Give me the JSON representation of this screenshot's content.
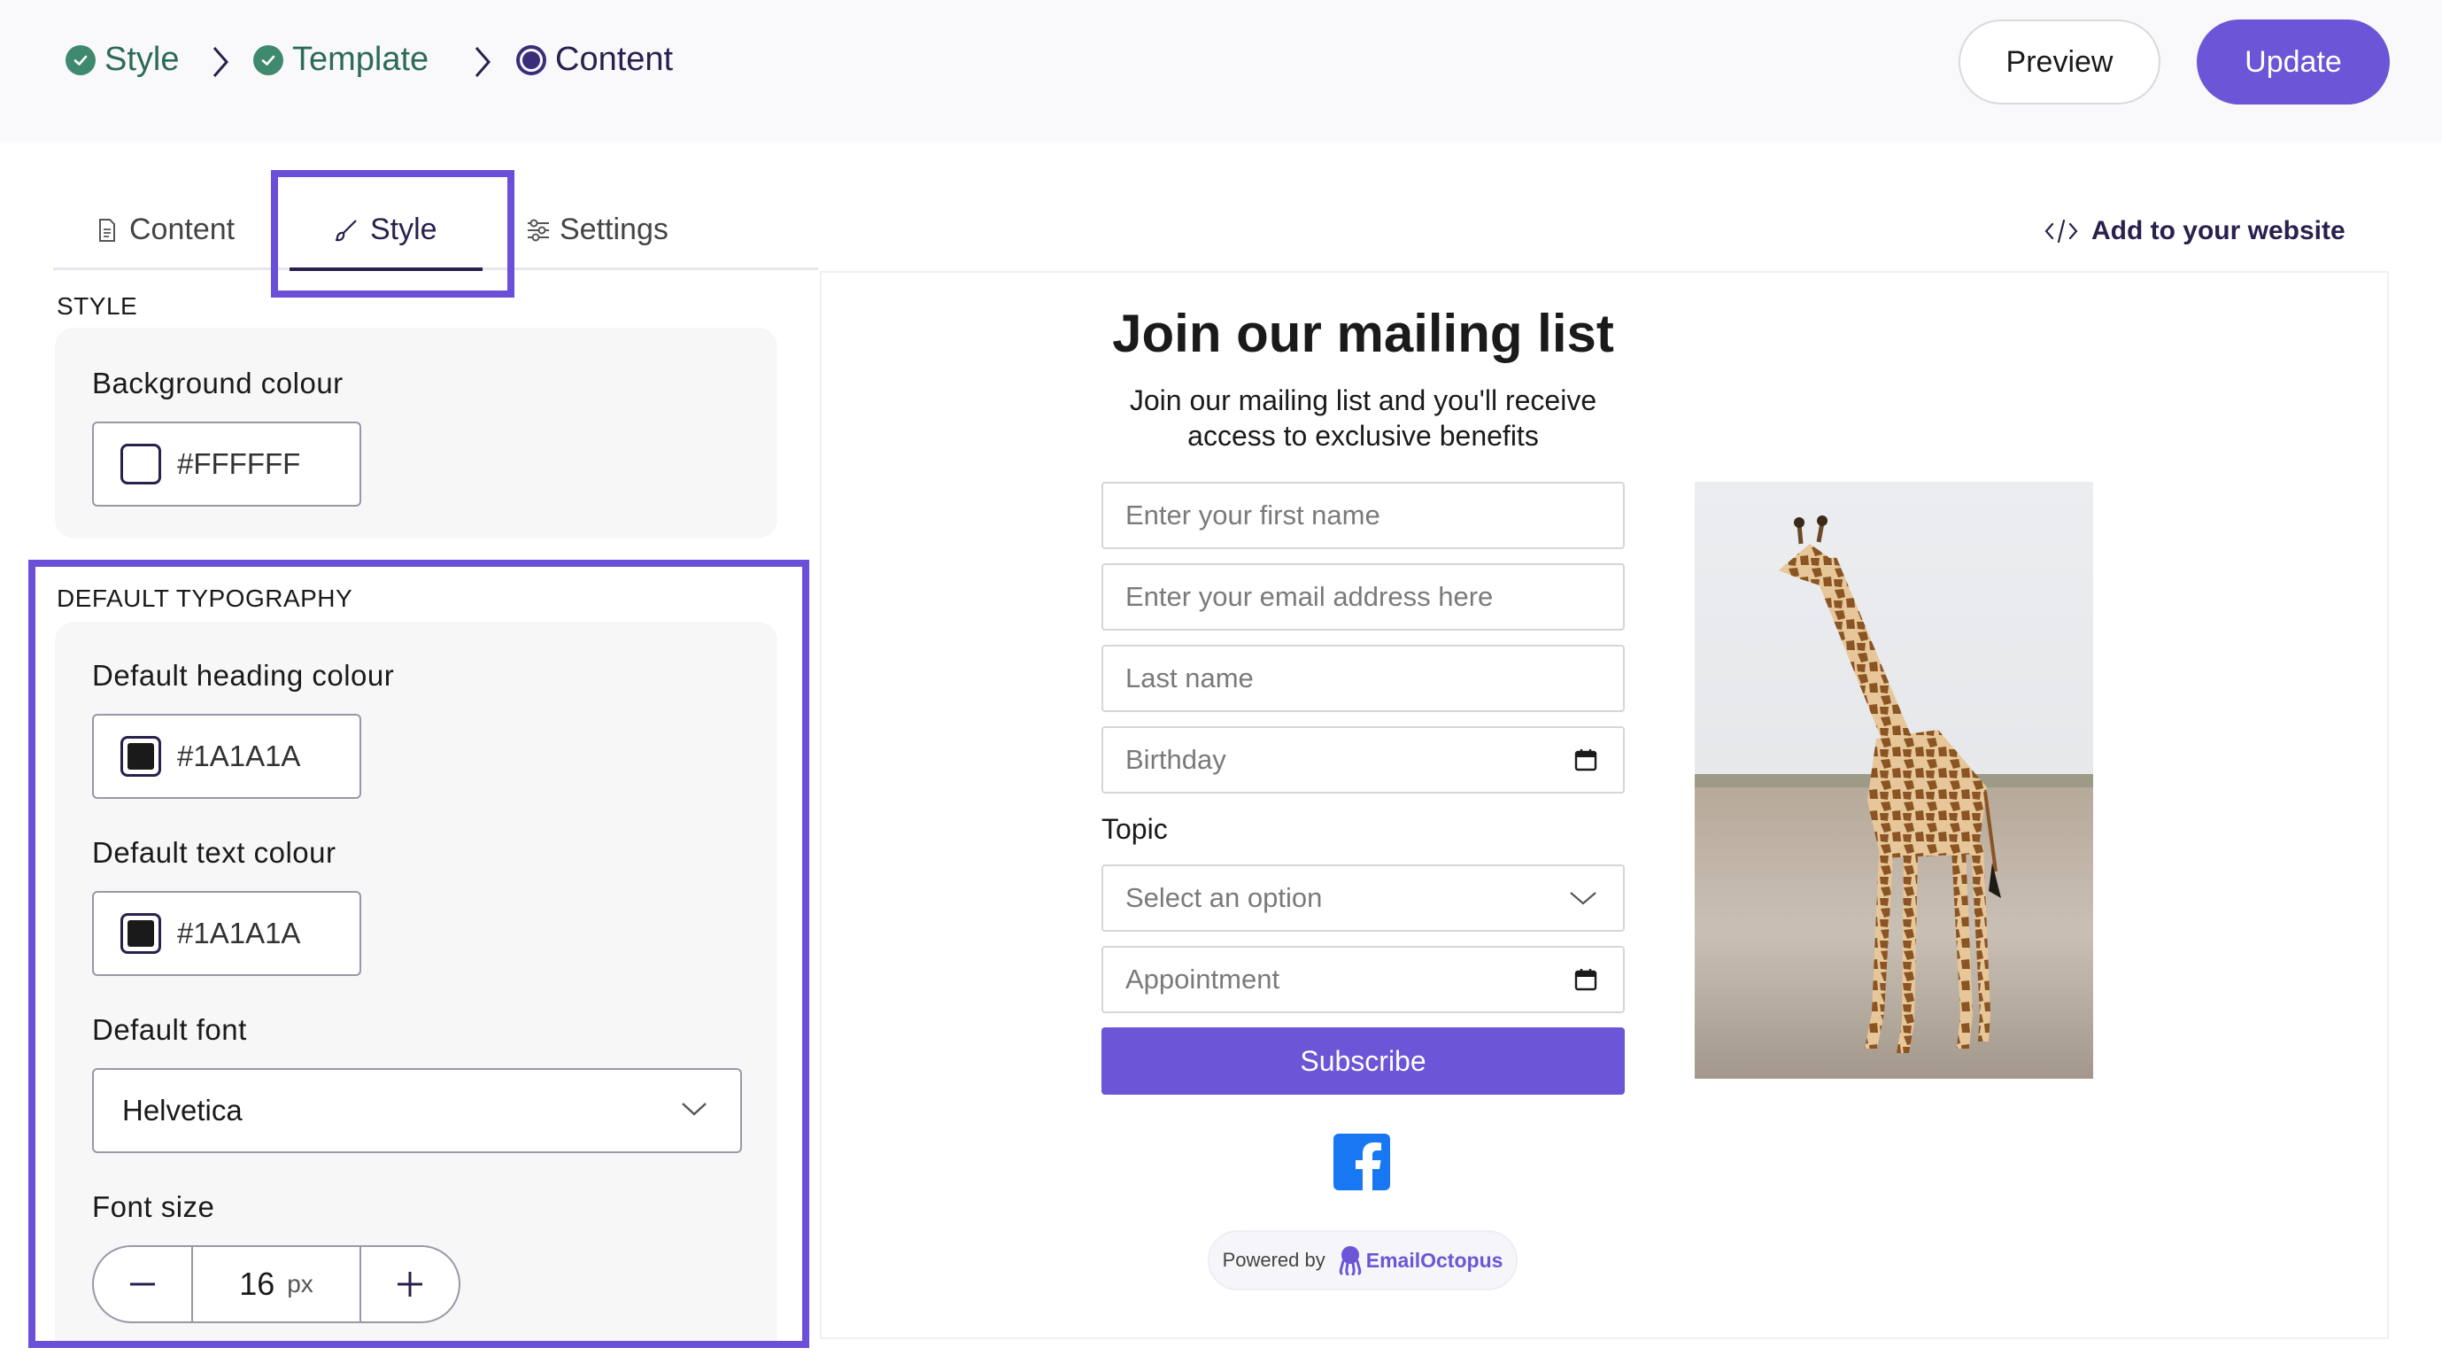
{
  "breadcrumb": {
    "steps": [
      {
        "label": "Style",
        "state": "done"
      },
      {
        "label": "Template",
        "state": "done"
      },
      {
        "label": "Content",
        "state": "current"
      }
    ]
  },
  "header": {
    "preview_label": "Preview",
    "update_label": "Update"
  },
  "tabs": {
    "content_label": "Content",
    "style_label": "Style",
    "settings_label": "Settings",
    "active": "Style",
    "add_to_website_label": "Add to your website"
  },
  "style_section": {
    "title": "STYLE",
    "background": {
      "label": "Background colour",
      "value": "#FFFFFF",
      "swatch": "#FFFFFF"
    }
  },
  "typography": {
    "title": "DEFAULT TYPOGRAPHY",
    "heading_colour": {
      "label": "Default heading colour",
      "value": "#1A1A1A",
      "swatch": "#1A1A1A"
    },
    "text_colour": {
      "label": "Default text colour",
      "value": "#1A1A1A",
      "swatch": "#1A1A1A"
    },
    "font": {
      "label": "Default font",
      "value": "Helvetica"
    },
    "font_size": {
      "label": "Font size",
      "value": "16",
      "unit": "px"
    }
  },
  "form": {
    "heading": "Join our mailing list",
    "description_line1": "Join our mailing list and you'll receive",
    "description_line2": "access to exclusive benefits",
    "first_name_placeholder": "Enter your first name",
    "email_placeholder": "Enter your email address here",
    "last_name_placeholder": "Last name",
    "birthday_placeholder": "Birthday",
    "topic_label": "Topic",
    "topic_select": "Select an option",
    "appointment_placeholder": "Appointment",
    "subscribe_label": "Subscribe",
    "powered_by": "Powered by",
    "brand": "EmailOctopus"
  },
  "colors": {
    "accent": "#6C55D6",
    "highlight_box": "#6B4FD8",
    "facebook": "#1877F2",
    "breadcrumb_done": "#2E6B57"
  },
  "icons": [
    "check-circle-icon",
    "chevron-right-icon",
    "document-icon",
    "brush-icon",
    "sliders-icon",
    "code-icon",
    "calendar-icon",
    "chevron-down-icon",
    "minus-icon",
    "plus-icon",
    "facebook-icon",
    "octopus-icon"
  ]
}
